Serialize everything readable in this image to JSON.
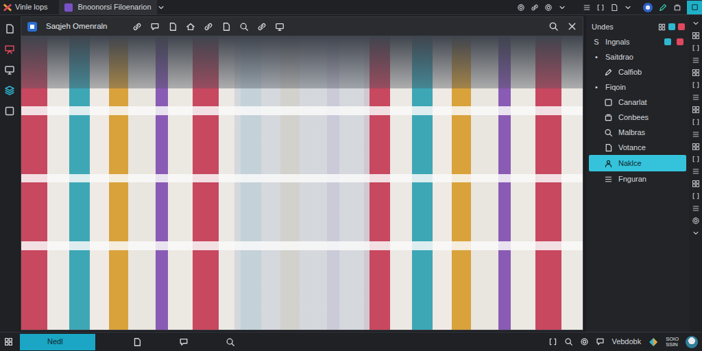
{
  "app": {
    "name": "Vinle lops"
  },
  "tabs": [
    {
      "label": "Bnoonorsi Filoenarion",
      "selected": true
    }
  ],
  "viewer": {
    "title": "Saqjeh Omenraln"
  },
  "side_panel": {
    "title": "Undes",
    "items": [
      {
        "kind": "letter",
        "marker": "S",
        "label": "Ingnals",
        "selected": false
      },
      {
        "kind": "bullet",
        "marker": "•",
        "label": "Saitdrao",
        "selected": false
      },
      {
        "kind": "icon",
        "label": "Calfiob",
        "selected": false
      },
      {
        "kind": "bullet",
        "marker": "•",
        "label": "Fiqoin",
        "selected": false
      },
      {
        "kind": "icon",
        "label": "Canarlat",
        "selected": false
      },
      {
        "kind": "icon",
        "label": "Conbees",
        "selected": false
      },
      {
        "kind": "icon",
        "label": "Malbras",
        "selected": false
      },
      {
        "kind": "icon",
        "label": "Votance",
        "selected": false
      },
      {
        "kind": "icon",
        "label": "Naklce",
        "selected": true
      },
      {
        "kind": "icon",
        "label": "Fnguran",
        "selected": false
      }
    ]
  },
  "bottom_tabs": [
    {
      "label": "Nedl",
      "selected": true
    }
  ],
  "status": {
    "label": "Vebdobk",
    "badge": [
      "SOIO",
      "SSIN"
    ]
  }
}
